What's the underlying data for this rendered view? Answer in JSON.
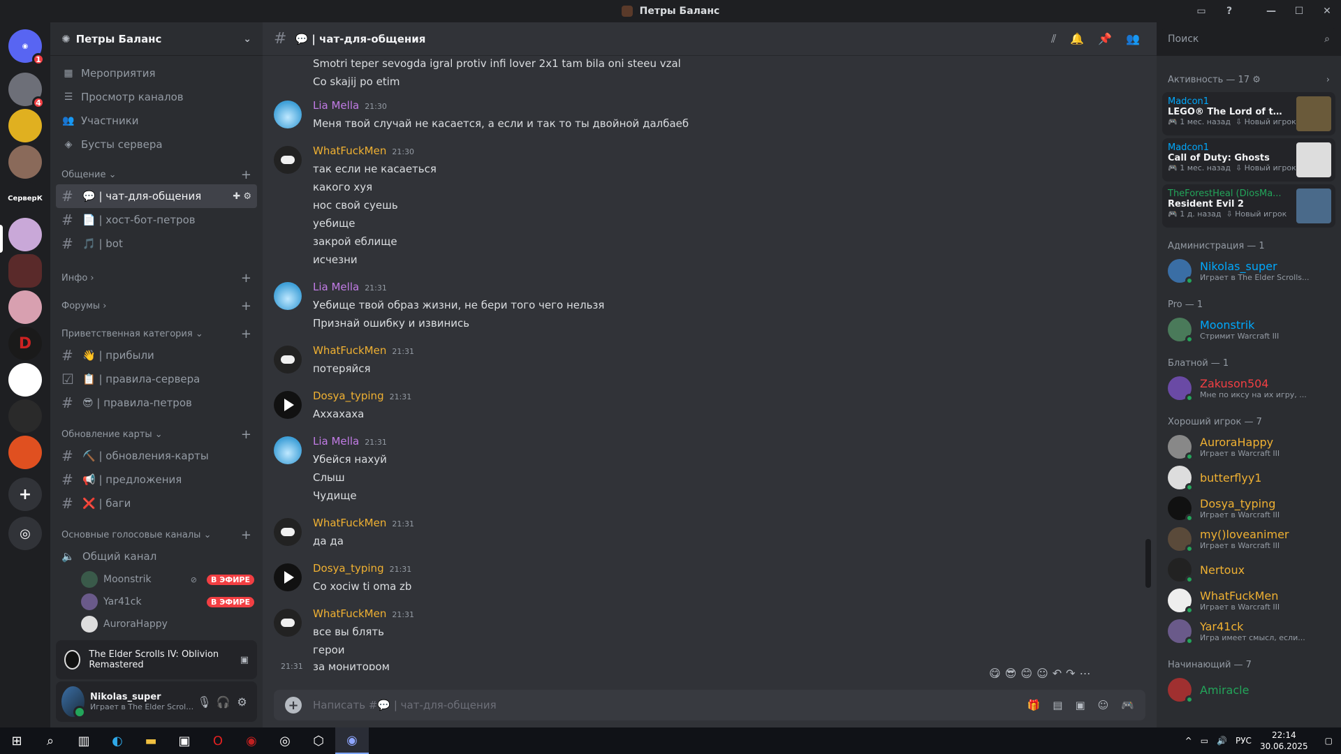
{
  "window": {
    "title": "Петры Баланс"
  },
  "server": {
    "name": "Петры Баланс",
    "nav": [
      {
        "label": "Мероприятия",
        "icon": "calendar-icon"
      },
      {
        "label": "Просмотр каналов",
        "icon": "browse-icon"
      },
      {
        "label": "Участники",
        "icon": "members-icon"
      },
      {
        "label": "Бусты сервера",
        "icon": "boost-icon"
      }
    ],
    "rail_label": "СерверК",
    "rail_badges": [
      "1",
      "4"
    ]
  },
  "categories": {
    "obshenie": "Общение",
    "info": "Инфо",
    "forums": "Форумы",
    "welcome": "Приветственная категория",
    "updates": "Обновление карты",
    "voice": "Основные голосовые каналы"
  },
  "channels": {
    "chat": "💬 | чат-для-общения",
    "host": "📄 | хост-бот-петров",
    "bot": "🎵 | bot",
    "arrived": "👋 | прибыли",
    "rules_server": "📋 | правила-сервера",
    "rules_petrov": "😎 | правила-петров",
    "map_updates": "⛏️ | обновления-карты",
    "suggestions": "📢 | предложения",
    "bugs": "❌ | баги",
    "voice_general": "Общий канал"
  },
  "voice_users": [
    {
      "name": "Moonstrik",
      "live": "В ЭФИРЕ"
    },
    {
      "name": "Yar41ck",
      "live": "В ЭФИРЕ"
    },
    {
      "name": "AuroraHappy",
      "live": ""
    }
  ],
  "activity_bar": {
    "game": "The Elder Scrolls IV: Oblivion Remastered"
  },
  "user_panel": {
    "name": "Nikolas_super",
    "status": "Играет в The Elder Scrolls IV: Oblivion Remastered"
  },
  "chat": {
    "channel_title": "💬 | чат-для-общения",
    "composer_placeholder": "Написать #💬 | чат-для-общения",
    "top_lines": [
      "Smotri teper sevogda igral protiv infi lover 2x1 tam bila oni steeu vzal",
      "Co skajij po etim"
    ],
    "messages": [
      {
        "author": "Lia Mella",
        "color": "#c27ce6",
        "time": "21:30",
        "avatar": "lia",
        "lines": [
          "Меня твой случай не касается, а если и так то ты двойной далбаеб"
        ]
      },
      {
        "author": "WhatFuckMen",
        "color": "#f0b132",
        "time": "21:30",
        "avatar": "what",
        "lines": [
          "так если не касаеться",
          "какого хуя",
          "нос свой суешь",
          "уебище",
          "закрой еблище",
          "исчезни"
        ]
      },
      {
        "author": "Lia Mella",
        "color": "#c27ce6",
        "time": "21:31",
        "avatar": "lia",
        "lines": [
          "Уебище твой образ жизни, не бери того чего нельзя",
          "Признай ошибку и извинись"
        ]
      },
      {
        "author": "WhatFuckMen",
        "color": "#f0b132",
        "time": "21:31",
        "avatar": "what",
        "lines": [
          "потеряйся"
        ]
      },
      {
        "author": "Dosya_typing",
        "color": "#f0b132",
        "time": "21:31",
        "avatar": "dos",
        "lines": [
          "Аххахаха"
        ]
      },
      {
        "author": "Lia Mella",
        "color": "#c27ce6",
        "time": "21:31",
        "avatar": "lia",
        "lines": [
          "Убейся нахуй",
          "Слыш",
          "Чудище"
        ]
      },
      {
        "author": "WhatFuckMen",
        "color": "#f0b132",
        "time": "21:31",
        "avatar": "what",
        "lines": [
          "да да"
        ]
      },
      {
        "author": "Dosya_typing",
        "color": "#f0b132",
        "time": "21:31",
        "avatar": "dos",
        "lines": [
          "Co xociw ti oma zb"
        ]
      },
      {
        "author": "WhatFuckMen",
        "color": "#f0b132",
        "time": "21:31",
        "avatar": "what",
        "lines": [
          "все вы блять",
          "герои"
        ]
      }
    ],
    "last_line": {
      "time": "21:31",
      "text": "за монитором"
    }
  },
  "search": {
    "placeholder": "Поиск"
  },
  "members": {
    "activity_title": "Активность — 17",
    "activity_cards": [
      {
        "who": "Madcon1",
        "game": "LEGO® The Lord of the Rings",
        "ago": "1 мес. назад",
        "tag": "Новый игрок",
        "who_color": "#00a8fc"
      },
      {
        "who": "Madcon1",
        "game": "Call of Duty: Ghosts",
        "ago": "1 мес. назад",
        "tag": "Новый игрок",
        "who_color": "#00a8fc"
      },
      {
        "who": "TheForestHeal (DiosMa...",
        "game": "Resident Evil 2",
        "ago": "1 д. назад",
        "tag": "Новый игрок",
        "who_color": "#23a55a"
      }
    ],
    "groups": [
      {
        "title": "Администрация — 1",
        "items": [
          {
            "name": "Nikolas_super",
            "color": "#00a8fc",
            "status": "Играет в The Elder Scrolls..."
          }
        ]
      },
      {
        "title": "Pro — 1",
        "items": [
          {
            "name": "Moonstrik",
            "color": "#00a8fc",
            "status": "Стримит Warcraft III"
          }
        ]
      },
      {
        "title": "Блатной — 1",
        "items": [
          {
            "name": "Zakuson504",
            "color": "#f23f43",
            "status": "Мне по иксу на их игру, ..."
          }
        ]
      },
      {
        "title": "Хороший игрок — 7",
        "items": [
          {
            "name": "AuroraHappy",
            "color": "#f0b132",
            "status": "Играет в Warcraft III"
          },
          {
            "name": "butterflyy1",
            "color": "#f0b132",
            "status": ""
          },
          {
            "name": "Dosya_typing",
            "color": "#f0b132",
            "status": "Играет в Warcraft III"
          },
          {
            "name": "my()loveanimer",
            "color": "#f0b132",
            "status": "Играет в Warcraft III"
          },
          {
            "name": "Nertoux",
            "color": "#f0b132",
            "status": ""
          },
          {
            "name": "WhatFuckMen",
            "color": "#f0b132",
            "status": "Играет в Warcraft III"
          },
          {
            "name": "Yar41ck",
            "color": "#f0b132",
            "status": "Игра имеет смысл, если..."
          }
        ]
      },
      {
        "title": "Начинающий — 7",
        "items": [
          {
            "name": "Amiracle",
            "color": "#23a55a",
            "status": ""
          }
        ]
      }
    ]
  },
  "taskbar": {
    "lang": "РУС",
    "time": "22:14",
    "date": "30.06.2025"
  }
}
